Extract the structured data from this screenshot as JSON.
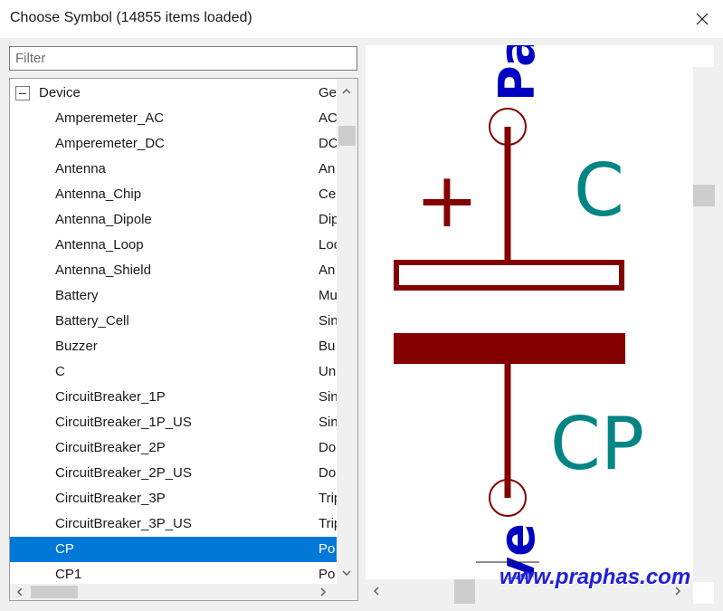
{
  "window": {
    "title": "Choose Symbol (14855 items loaded)"
  },
  "filter": {
    "placeholder": "Filter",
    "value": ""
  },
  "tree": {
    "parent": {
      "name": "Device",
      "desc": "Ge"
    },
    "items": [
      {
        "name": "Amperemeter_AC",
        "desc": "AC"
      },
      {
        "name": "Amperemeter_DC",
        "desc": "DC"
      },
      {
        "name": "Antenna",
        "desc": "An"
      },
      {
        "name": "Antenna_Chip",
        "desc": "Ce"
      },
      {
        "name": "Antenna_Dipole",
        "desc": "Dip"
      },
      {
        "name": "Antenna_Loop",
        "desc": "Loo"
      },
      {
        "name": "Antenna_Shield",
        "desc": "An"
      },
      {
        "name": "Battery",
        "desc": "Mu"
      },
      {
        "name": "Battery_Cell",
        "desc": "Sin"
      },
      {
        "name": "Buzzer",
        "desc": "Bu"
      },
      {
        "name": "C",
        "desc": "Un"
      },
      {
        "name": "CircuitBreaker_1P",
        "desc": "Sin"
      },
      {
        "name": "CircuitBreaker_1P_US",
        "desc": "Sin"
      },
      {
        "name": "CircuitBreaker_2P",
        "desc": "Do"
      },
      {
        "name": "CircuitBreaker_2P_US",
        "desc": "Do"
      },
      {
        "name": "CircuitBreaker_3P",
        "desc": "Trip"
      },
      {
        "name": "CircuitBreaker_3P_US",
        "desc": "Trip"
      },
      {
        "name": "CP",
        "desc": "Po",
        "selected": true
      },
      {
        "name": "CP1",
        "desc": "Po"
      }
    ]
  },
  "preview": {
    "top_text": "Pa",
    "plus": "+",
    "ref_label": "C",
    "value_label": "CP",
    "bottom_text": "ve",
    "colors": {
      "body": "#840000",
      "ref": "#008484",
      "field": "#0000c2"
    }
  },
  "watermark": "www.praphas.com"
}
